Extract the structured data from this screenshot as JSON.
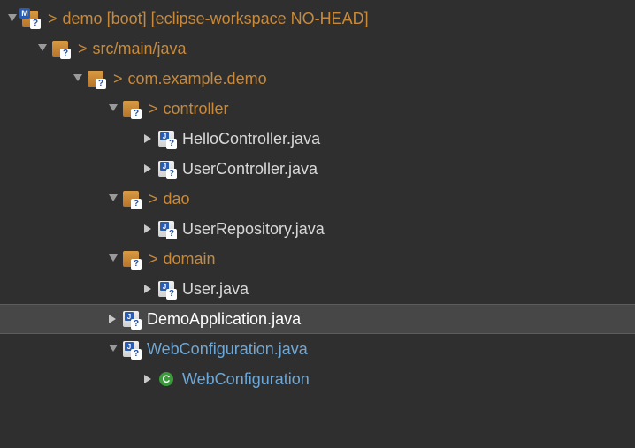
{
  "project": {
    "name": "demo",
    "suffix": "[boot] [eclipse-workspace NO-HEAD]"
  },
  "srcFolder": "src/main/java",
  "package": "com.example.demo",
  "controllerPkg": "controller",
  "controllerFiles": [
    "HelloController.java",
    "UserController.java"
  ],
  "daoPkg": "dao",
  "daoFiles": [
    "UserRepository.java"
  ],
  "domainPkg": "domain",
  "domainFiles": [
    "User.java"
  ],
  "appFile": "DemoApplication.java",
  "webConfigFile": "WebConfiguration.java",
  "webConfigClass": "WebConfiguration",
  "gt": ">"
}
